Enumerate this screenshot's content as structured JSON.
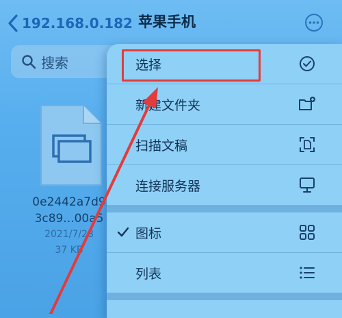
{
  "nav": {
    "back_label": "192.168.0.182",
    "title": "苹果手机"
  },
  "search": {
    "placeholder": "搜索"
  },
  "file": {
    "name_line1": "0e2442a7d9",
    "name_line2": "3c89...00a5",
    "date": "2021/7/28",
    "size": "37 KB"
  },
  "menu": {
    "items": [
      {
        "label": "选择",
        "icon": "checkmark-circle-icon"
      },
      {
        "label": "新建文件夹",
        "icon": "new-folder-icon"
      },
      {
        "label": "扫描文稿",
        "icon": "scan-document-icon"
      },
      {
        "label": "连接服务器",
        "icon": "monitor-icon"
      }
    ],
    "view_items": [
      {
        "label": "图标",
        "icon": "grid-icon",
        "checked": true
      },
      {
        "label": "列表",
        "icon": "list-icon",
        "checked": false
      }
    ]
  },
  "colors": {
    "highlight": "#e33b3b",
    "accent": "#1c67b7"
  }
}
